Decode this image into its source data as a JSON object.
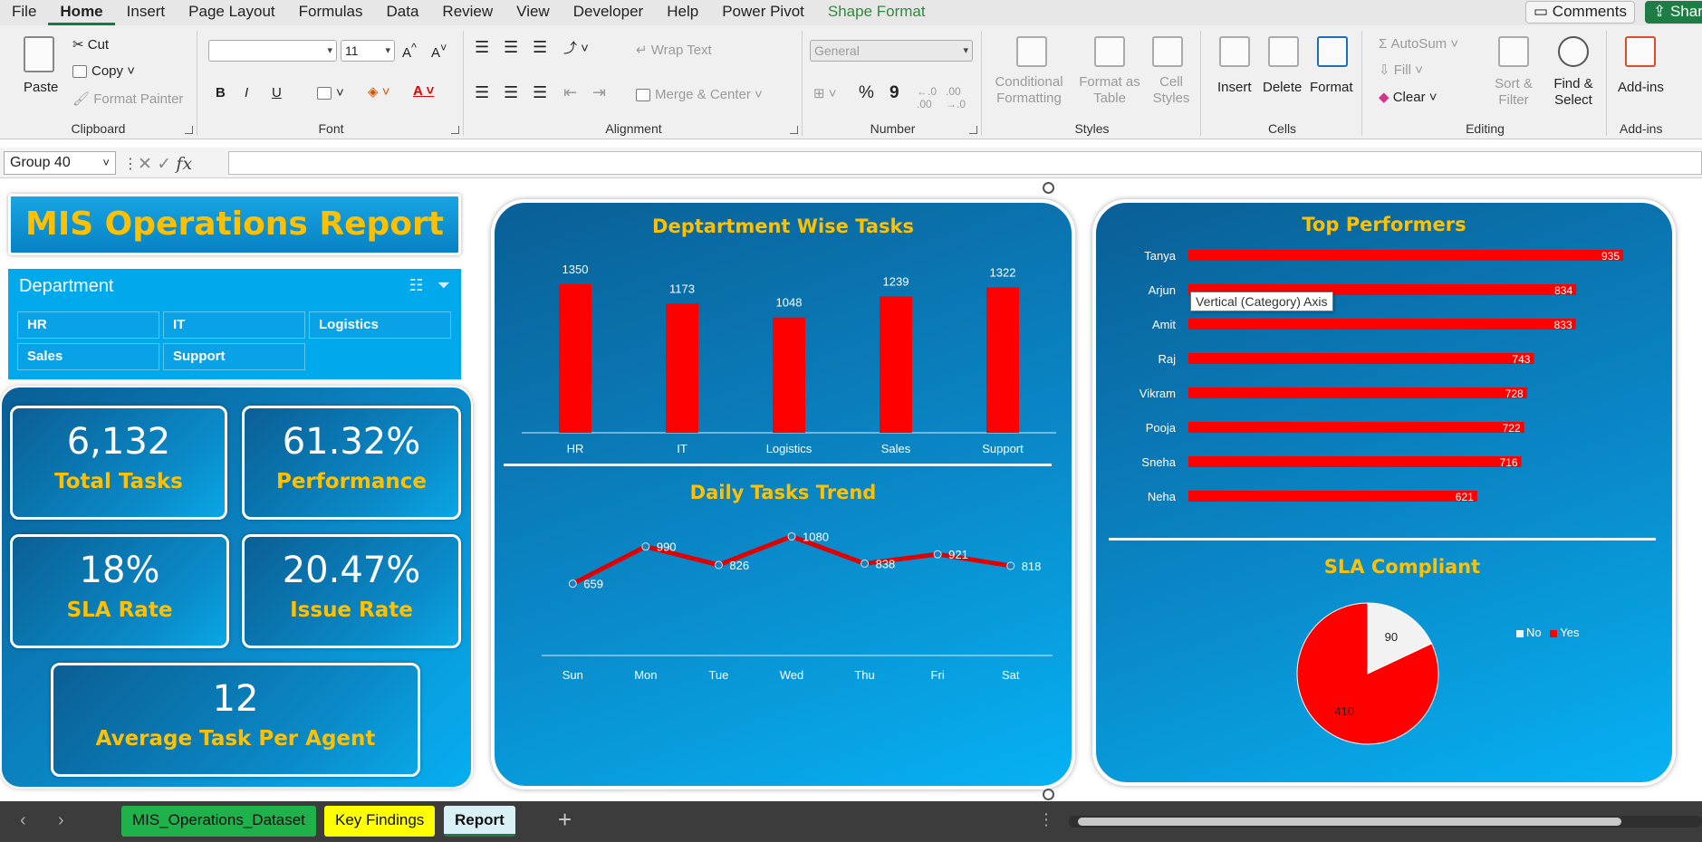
{
  "menu": {
    "items": [
      "File",
      "Home",
      "Insert",
      "Page Layout",
      "Formulas",
      "Data",
      "Review",
      "View",
      "Developer",
      "Help",
      "Power Pivot",
      "Shape Format"
    ],
    "active": "Home",
    "comments": "Comments",
    "share": "Share"
  },
  "ribbon": {
    "clipboard": {
      "paste": "Paste",
      "cut": "Cut",
      "copy": "Copy",
      "format_painter": "Format Painter",
      "label": "Clipboard"
    },
    "font": {
      "font_name": "",
      "font_size": "11",
      "grow": "A^",
      "shrink": "A˅",
      "bold": "B",
      "italic": "I",
      "underline": "U",
      "label": "Font"
    },
    "alignment": {
      "wrap_text": "Wrap Text",
      "merge_center": "Merge & Center",
      "label": "Alignment"
    },
    "number": {
      "format": "General",
      "percent": "%",
      "comma": "9",
      "label": "Number"
    },
    "styles": {
      "conditional": "Conditional Formatting",
      "format_as_table": "Format as Table",
      "cell_styles": "Cell Styles",
      "label": "Styles"
    },
    "cells": {
      "insert": "Insert",
      "delete": "Delete",
      "format": "Format",
      "label": "Cells"
    },
    "editing": {
      "autosum": "AutoSum",
      "fill": "Fill",
      "clear": "Clear",
      "sort_filter": "Sort & Filter",
      "find_select": "Find & Select",
      "label": "Editing"
    },
    "addins": {
      "addins": "Add-ins",
      "label": "Add-ins"
    }
  },
  "formula_bar": {
    "name_box": "Group 40",
    "fx": "fx",
    "formula": ""
  },
  "dashboard": {
    "title": "MIS Operations Report",
    "slicer": {
      "header": "Department",
      "items": [
        "HR",
        "IT",
        "Logistics",
        "Sales",
        "Support"
      ]
    },
    "kpis": [
      {
        "value": "6,132",
        "label": "Total Tasks"
      },
      {
        "value": "61.32%",
        "label": "Performance"
      },
      {
        "value": "18%",
        "label": "SLA Rate"
      },
      {
        "value": "20.47%",
        "label": "Issue Rate"
      },
      {
        "value": "12",
        "label": "Average Task Per Agent"
      }
    ],
    "tooltip": "Vertical (Category) Axis"
  },
  "chart_data": [
    {
      "type": "bar",
      "title": "Deptartment Wise Tasks",
      "categories": [
        "HR",
        "IT",
        "Logistics",
        "Sales",
        "Support"
      ],
      "values": [
        1350,
        1173,
        1048,
        1239,
        1322
      ],
      "ylim": [
        0,
        1400
      ],
      "color": "#ff0000"
    },
    {
      "type": "line",
      "title": "Daily Tasks Trend",
      "categories": [
        "Sun",
        "Mon",
        "Tue",
        "Wed",
        "Thu",
        "Fri",
        "Sat"
      ],
      "values": [
        659,
        990,
        826,
        1080,
        838,
        921,
        818
      ],
      "color": "#e00000"
    },
    {
      "type": "bar",
      "orientation": "horizontal",
      "title": "Top Performers",
      "categories": [
        "Tanya",
        "Arjun",
        "Amit",
        "Raj",
        "Vikram",
        "Pooja",
        "Sneha",
        "Neha"
      ],
      "values": [
        935,
        834,
        833,
        743,
        728,
        722,
        716,
        621
      ],
      "color": "#ff0000"
    },
    {
      "type": "pie",
      "title": "SLA Compliant",
      "categories": [
        "No",
        "Yes"
      ],
      "values": [
        90,
        410
      ],
      "colors": [
        "#f2f2f2",
        "#ff0000"
      ],
      "legend": "right"
    }
  ],
  "sheet_tabs": [
    {
      "name": "MIS_Operations_Dataset",
      "color": "#1fb24a"
    },
    {
      "name": "Key Findings",
      "color": "#ffff00"
    },
    {
      "name": "Report",
      "color": "#d9f1f5",
      "active": true
    }
  ]
}
